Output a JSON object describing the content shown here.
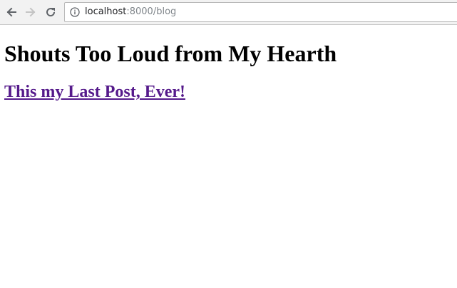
{
  "browser": {
    "url_host": "localhost",
    "url_rest": ":8000/blog",
    "icons": {
      "back": "arrow-left-icon",
      "forward": "arrow-right-icon",
      "reload": "reload-icon",
      "info": "info-icon"
    }
  },
  "page": {
    "site_title": "Shouts Too Loud from My Hearth",
    "posts": [
      {
        "title": "This my Last Post, Ever!"
      }
    ]
  },
  "colors": {
    "visited_link": "#551a8b",
    "toolbar_bg": "#f2f2f2"
  }
}
